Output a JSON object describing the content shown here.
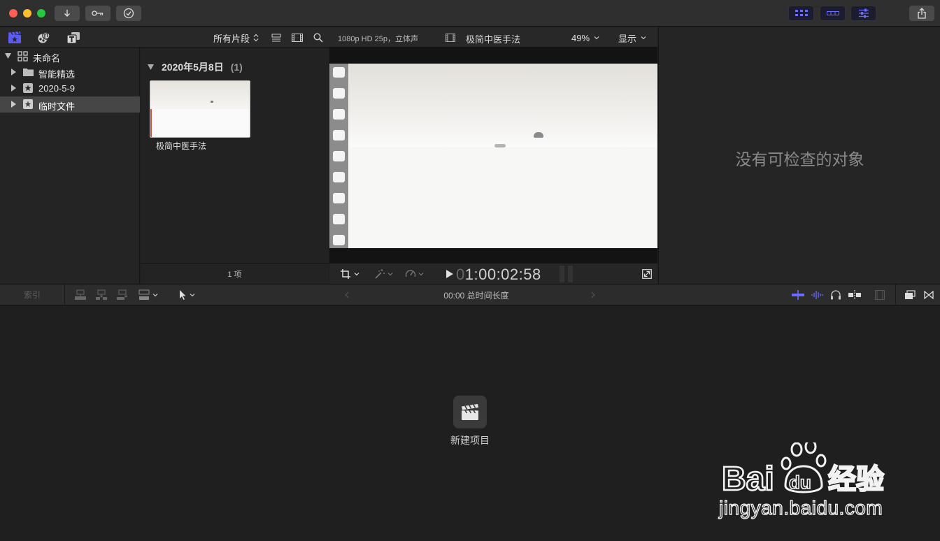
{
  "titlebar": {
    "icons": [
      "import-download-icon",
      "keywords-key-icon",
      "background-tasks-check-icon"
    ],
    "layout_icons": [
      "browser-layout-icon",
      "timeline-layout-icon",
      "inspector-layout-icon"
    ],
    "share_icon": "share-icon"
  },
  "sidebar_tabs": [
    "libraries-tab-icon",
    "photos-audio-tab-icon",
    "titles-generators-tab-icon"
  ],
  "browser_filter": {
    "label": "所有片段"
  },
  "libraries": [
    {
      "label": "未命名",
      "icon": "library-icon"
    },
    {
      "label": "智能精选",
      "icon": "folder-icon"
    },
    {
      "label": "2020-5-9",
      "icon": "event-star-icon"
    },
    {
      "label": "临时文件",
      "icon": "event-star-icon",
      "selected": true
    }
  ],
  "browser": {
    "group_title": "2020年5月8日",
    "group_count": "(1)",
    "clip_name": "极简中医手法",
    "footer": "1 项"
  },
  "viewer": {
    "format": "1080p HD 25p，立体声",
    "title": "极简中医手法",
    "zoom": "49%",
    "view_menu": "显示",
    "timecode_dim": "0",
    "timecode": "1:00:02:58"
  },
  "inspector": {
    "empty_message": "没有可检查的对象"
  },
  "timeline": {
    "index_label": "索引",
    "duration": "00:00 总时间长度",
    "new_project_label": "新建项目"
  },
  "watermark": {
    "logo_text": "Bai du 经验",
    "url": "jingyan.baidu.com"
  },
  "colors": {
    "accent_blue": "#5b5bf0",
    "selection": "#464646",
    "close": "#fe5f57",
    "minimize": "#febc2e",
    "zoom": "#28c840"
  }
}
